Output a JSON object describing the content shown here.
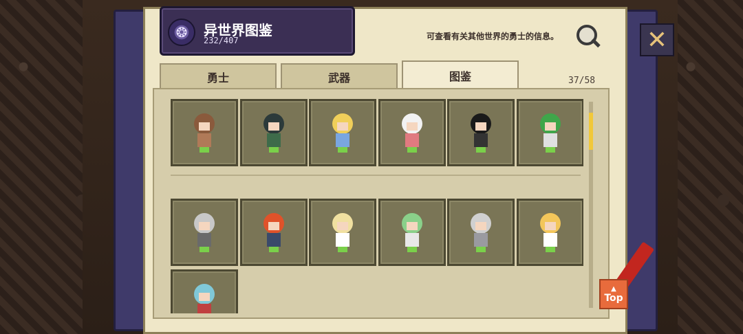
{
  "header": {
    "title": "异世界图鉴",
    "count": "232/407",
    "info": "可查看有关其他世界的勇士的信息。"
  },
  "tabs": [
    {
      "label": "勇士",
      "active": false
    },
    {
      "label": "武器",
      "active": false
    },
    {
      "label": "图鉴",
      "active": true
    }
  ],
  "counter": "37/58",
  "top_button": {
    "label": "Top",
    "arrow": "▲"
  },
  "close_glyph": "✕",
  "emblem_glyph": "❂",
  "characters": [
    {
      "name": "character-1-icon",
      "hair": "#8a5a3c",
      "outfit": "#b07a58"
    },
    {
      "name": "character-2-icon",
      "hair": "#2c3a3a",
      "outfit": "#3e6b4a"
    },
    {
      "name": "character-3-icon",
      "hair": "#f0cf5a",
      "outfit": "#7aa6e0"
    },
    {
      "name": "character-4-icon",
      "hair": "#f2f2f2",
      "outfit": "#e07a80"
    },
    {
      "name": "character-5-icon",
      "hair": "#1a1a1a",
      "outfit": "#333333"
    },
    {
      "name": "character-6-icon",
      "hair": "#3fa64a",
      "outfit": "#e0e0e0"
    },
    {
      "name": "character-7-icon",
      "hair": "#c8c8c8",
      "outfit": "#6a6a6a"
    },
    {
      "name": "character-8-icon",
      "hair": "#e0522a",
      "outfit": "#3a4a6a"
    },
    {
      "name": "character-9-icon",
      "hair": "#f0e0a0",
      "outfit": "#ffffff"
    },
    {
      "name": "character-10-icon",
      "hair": "#8ad08a",
      "outfit": "#e8e8e8"
    },
    {
      "name": "character-11-icon",
      "hair": "#d0d0d0",
      "outfit": "#9a9aa0"
    },
    {
      "name": "character-12-icon",
      "hair": "#f3c65a",
      "outfit": "#ffffff"
    },
    {
      "name": "character-13-icon",
      "hair": "#80c8d8",
      "outfit": "#c04040"
    }
  ]
}
